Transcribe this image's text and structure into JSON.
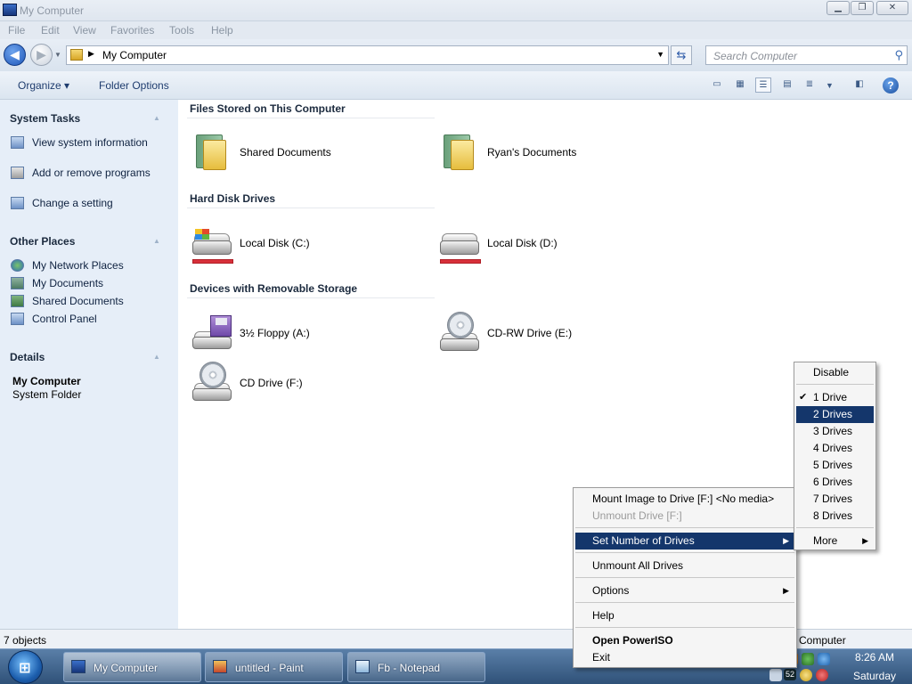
{
  "window": {
    "title": "My Computer"
  },
  "menu": [
    "File",
    "Edit",
    "View",
    "Favorites",
    "Tools",
    "Help"
  ],
  "address": {
    "path": "My Computer",
    "search_placeholder": "Search Computer"
  },
  "toolbar": {
    "organize": "Organize",
    "folder_options": "Folder Options"
  },
  "sidebar": {
    "system_tasks": {
      "title": "System Tasks",
      "items": [
        "View system information",
        "Add or remove programs",
        "Change a setting"
      ]
    },
    "other_places": {
      "title": "Other Places",
      "items": [
        "My Network Places",
        "My Documents",
        "Shared Documents",
        "Control Panel"
      ]
    },
    "details": {
      "title": "Details",
      "name": "My Computer",
      "type": "System Folder"
    }
  },
  "groups": [
    {
      "title": "Files Stored on This Computer",
      "items": [
        "Shared Documents",
        "Ryan's Documents"
      ]
    },
    {
      "title": "Hard Disk Drives",
      "items": [
        "Local Disk (C:)",
        "Local Disk (D:)"
      ]
    },
    {
      "title": "Devices with Removable Storage",
      "items": [
        "3½ Floppy (A:)",
        "CD-RW Drive (E:)",
        "CD Drive (F:)"
      ]
    }
  ],
  "status": {
    "objects": "7 objects",
    "right": "Computer"
  },
  "context_menu": [
    {
      "label": "Mount Image to Drive [F:] <No media>"
    },
    {
      "label": "Unmount Drive [F:]",
      "disabled": true
    },
    {
      "label": "Set Number of Drives",
      "selected": true,
      "submenu": true
    },
    {
      "label": "Unmount All Drives"
    },
    {
      "label": "Options",
      "submenu": true
    },
    {
      "label": "Help"
    },
    {
      "label": "Open PowerISO",
      "bold": true
    },
    {
      "label": "Exit"
    }
  ],
  "submenu": [
    {
      "label": "Disable"
    },
    {
      "label": "1 Drive",
      "checked": true
    },
    {
      "label": "2 Drives",
      "selected": true
    },
    {
      "label": "3 Drives"
    },
    {
      "label": "4 Drives"
    },
    {
      "label": "5 Drives"
    },
    {
      "label": "6 Drives"
    },
    {
      "label": "7 Drives"
    },
    {
      "label": "8 Drives"
    },
    {
      "label": "More",
      "submenu": true
    }
  ],
  "taskbar": {
    "buttons": [
      "My Computer",
      "untitled - Paint",
      "Fb - Notepad"
    ],
    "clock_time": "8:26 AM",
    "clock_day": "Saturday",
    "tray_badge": "52"
  },
  "colors": {
    "selection": "#14366b",
    "sidebar_bg": "#e6eef8",
    "taskbar": "#2f5178"
  }
}
